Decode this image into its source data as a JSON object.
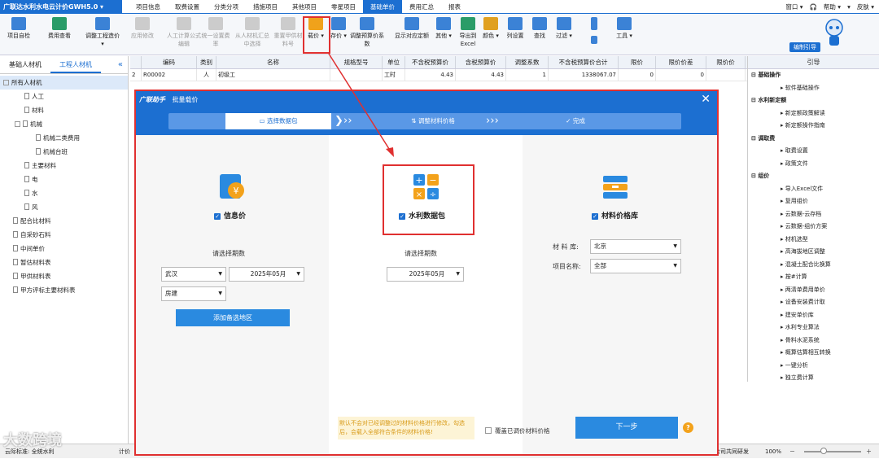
{
  "app": {
    "name": "广联达水利水电云计价GWH5.0 ▾",
    "tabs": [
      "项目信息",
      "取费设置",
      "分类分项",
      "措施项目",
      "其他项目",
      "零星项目",
      "基础单价",
      "费用汇总",
      "报表"
    ],
    "active_tab": "基础单价",
    "right_tools": [
      "窗口 ▾",
      "🎧",
      "帮助 ▾",
      "▾",
      "皮肤 ▾"
    ]
  },
  "toolbar": {
    "buttons": [
      {
        "label": "项目自检",
        "enabled": true
      },
      {
        "label": "费用查看",
        "enabled": true
      },
      {
        "label": "调整工程造价 ▾",
        "enabled": true
      },
      {
        "label": "应用修改",
        "enabled": false
      },
      {
        "label": "人工计算公式编辑",
        "enabled": false
      },
      {
        "label": "统一设置费率",
        "enabled": false
      },
      {
        "label": "从人材机汇总中选择",
        "enabled": false
      },
      {
        "label": "重置甲供材料号",
        "enabled": false
      },
      {
        "label": "载价 ▾",
        "enabled": true
      },
      {
        "label": "存价 ▾",
        "enabled": true
      },
      {
        "label": "调整预算价系数",
        "enabled": true
      },
      {
        "label": "显示对应定额",
        "enabled": true
      },
      {
        "label": "其他 ▾",
        "enabled": true
      },
      {
        "label": "导出到Excel",
        "enabled": true
      },
      {
        "label": "颜色 ▾",
        "enabled": true
      },
      {
        "label": "列设置",
        "enabled": true
      },
      {
        "label": "查找",
        "enabled": true
      },
      {
        "label": "过滤 ▾",
        "enabled": true
      },
      {
        "label": "工具 ▾",
        "enabled": true
      }
    ],
    "help_label": "编制引导"
  },
  "left_panel": {
    "tabs": [
      "基础人材机",
      "工程人材机"
    ],
    "active_tab": "工程人材机",
    "collapse": "«",
    "tree": [
      {
        "label": "所有人材机",
        "level": 0,
        "selected": true
      },
      {
        "label": "人工",
        "level": 1
      },
      {
        "label": "材料",
        "level": 1
      },
      {
        "label": "机械",
        "level": 1
      },
      {
        "label": "机械二类费用",
        "level": 2
      },
      {
        "label": "机械台班",
        "level": 2
      },
      {
        "label": "主要材料",
        "level": 1
      },
      {
        "label": "电",
        "level": 1
      },
      {
        "label": "水",
        "level": 1
      },
      {
        "label": "风",
        "level": 1
      },
      {
        "label": "配合比材料",
        "level": 0
      },
      {
        "label": "自采砂石料",
        "level": 0
      },
      {
        "label": "中间单价",
        "level": 0
      },
      {
        "label": "暂估材料表",
        "level": 0
      },
      {
        "label": "甲供材料表",
        "level": 0
      },
      {
        "label": "甲方评标主要材料表",
        "level": 0
      }
    ]
  },
  "grid": {
    "columns": [
      "编码",
      "类别",
      "名称",
      "规格型号",
      "单位",
      "不含税预算价",
      "含税预算价",
      "调整系数",
      "不含税预算价合计",
      "限价",
      "限价价差",
      "限价价"
    ],
    "rows": [
      {
        "no": "2",
        "cells": [
          "R00002",
          "人",
          "初级工",
          "",
          "工时",
          "4.43",
          "4.43",
          "1",
          "1338067.07",
          "0",
          "0",
          ""
        ]
      }
    ]
  },
  "right_panel": {
    "title": "引导",
    "items": [
      {
        "label": "基础操作",
        "type": "sec"
      },
      {
        "label": "软件基础操作",
        "type": "sub"
      },
      {
        "label": "水利新定额",
        "type": "sec"
      },
      {
        "label": "新定额政策解读",
        "type": "sub"
      },
      {
        "label": "新定额操作指南",
        "type": "sub"
      },
      {
        "label": "调取费",
        "type": "sec"
      },
      {
        "label": "取费设置",
        "type": "sub"
      },
      {
        "label": "政策文件",
        "type": "sub"
      },
      {
        "label": "组价",
        "type": "sec"
      },
      {
        "label": "导入Excel文件",
        "type": "sub"
      },
      {
        "label": "复用组价",
        "type": "sub"
      },
      {
        "label": "云数据-云存档",
        "type": "sub"
      },
      {
        "label": "云数据-组价方案",
        "type": "sub"
      },
      {
        "label": "材机选型",
        "type": "sub"
      },
      {
        "label": "高海拔地区调整",
        "type": "sub"
      },
      {
        "label": "混凝土配合比换算",
        "type": "sub"
      },
      {
        "label": "按#计算",
        "type": "sub"
      },
      {
        "label": "两清单费用单价",
        "type": "sub"
      },
      {
        "label": "设备安装费计取",
        "type": "sub"
      },
      {
        "label": "建安单价库",
        "type": "sub"
      },
      {
        "label": "水利专业算法",
        "type": "sub"
      },
      {
        "label": "骨料水泥系统",
        "type": "sub"
      },
      {
        "label": "概算估算相互转换",
        "type": "sub"
      },
      {
        "label": "一键分析",
        "type": "sub"
      },
      {
        "label": "独立费计算",
        "type": "sub"
      }
    ]
  },
  "status_bar": {
    "left": "云际标准: 全统水利",
    "mid": "计价",
    "right_text": "公司共同研发",
    "zoom": "100%"
  },
  "watermark": "大数跨境",
  "dialog": {
    "logo": "广联助手",
    "title": "批量载价",
    "close": "✕",
    "steps": [
      "选择数据包",
      "调整材料价格",
      "完成"
    ],
    "active_step": 0,
    "sources": [
      {
        "label": "信息价",
        "checked": true
      },
      {
        "label": "水利数据包",
        "checked": true
      },
      {
        "label": "材料价格库",
        "checked": true
      }
    ],
    "info_price": {
      "period_label": "请选择期数",
      "region": "武汉",
      "period": "2025年05月",
      "type": "房建",
      "add_button": "添加备选地区"
    },
    "water_package": {
      "period_label": "请选择期数",
      "period": "2025年05月"
    },
    "material_lib": {
      "lib_label": "材 料 库:",
      "lib_value": "北京",
      "project_label": "项目名称:",
      "project_value": "全部"
    },
    "notice": "默认不会对已经调整过的材料价格进行修改，勾选后，会载入全部符合条件的材料价格!",
    "overwrite_label": "覆盖已调价材料价格",
    "next_button": "下一步",
    "help_icon": "?"
  },
  "colors": {
    "brand": "#1c6fd1",
    "highlight": "#e03030",
    "button": "#2a8ae0"
  }
}
